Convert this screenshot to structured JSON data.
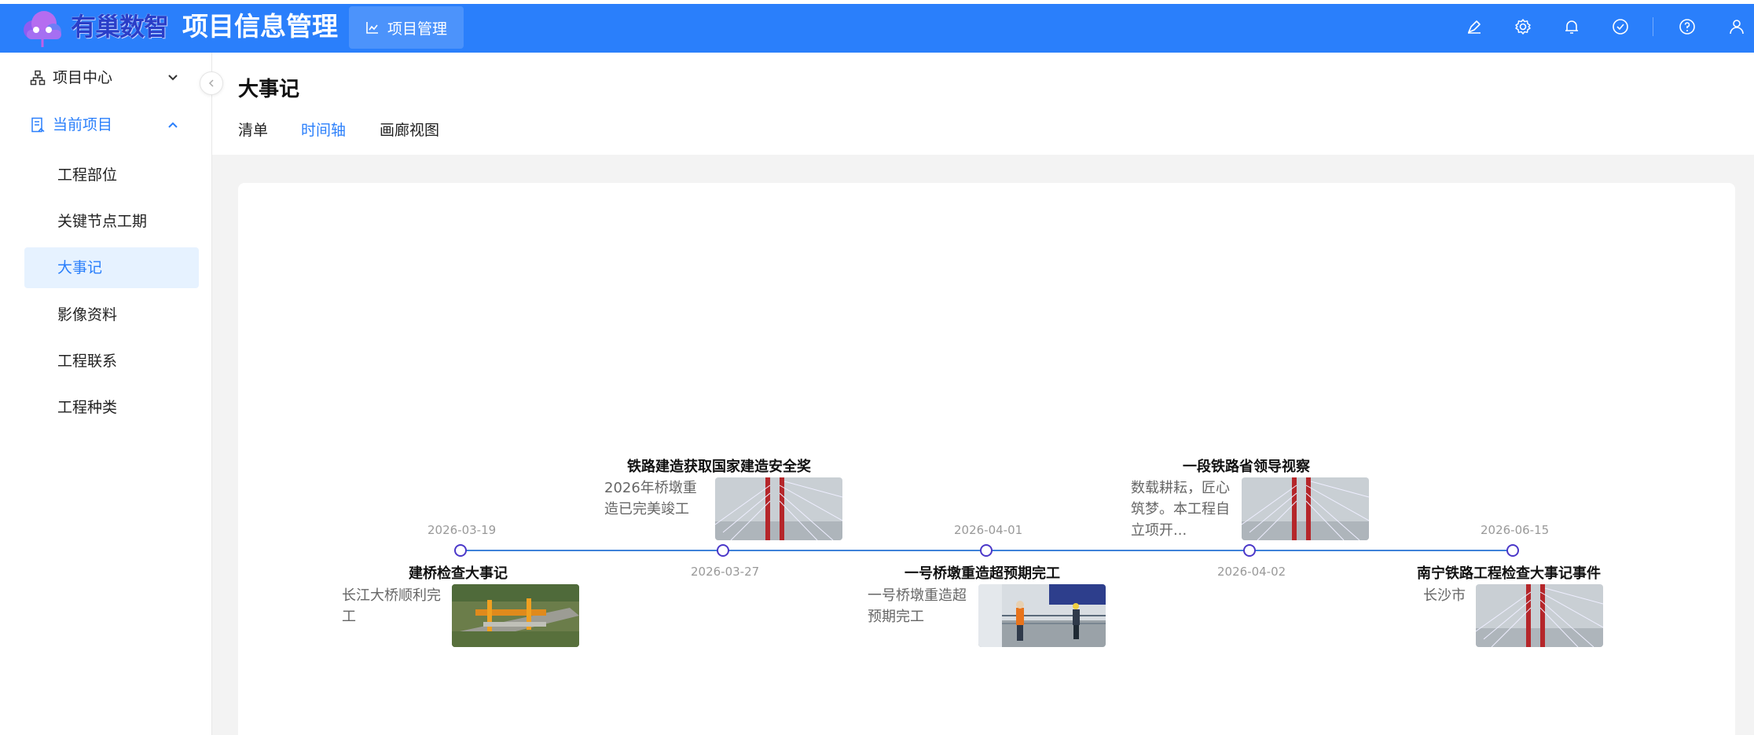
{
  "header": {
    "brand_name": "有巢数智",
    "app_title": "项目信息管理",
    "module_tab": "项目管理",
    "icons": [
      "pen-icon",
      "settings-icon",
      "bell-icon",
      "check-circle-icon",
      "help-icon",
      "user-icon"
    ],
    "accent_color": "#2a7ffb"
  },
  "sidebar": {
    "groups": [
      {
        "label": "项目中心",
        "icon": "org-chart-icon",
        "expanded": false
      },
      {
        "label": "当前项目",
        "icon": "project-doc-icon",
        "expanded": true
      }
    ],
    "items": [
      {
        "label": "工程部位"
      },
      {
        "label": "关键节点工期"
      },
      {
        "label": "大事记",
        "selected": true
      },
      {
        "label": "影像资料"
      },
      {
        "label": "工程联系"
      },
      {
        "label": "工程种类"
      }
    ]
  },
  "page": {
    "title": "大事记",
    "tabs": [
      {
        "label": "清单"
      },
      {
        "label": "时间轴",
        "active": true
      },
      {
        "label": "画廊视图"
      }
    ]
  },
  "timeline": {
    "events": [
      {
        "date": "2026-03-19",
        "title": "建桥检查大事记",
        "desc": "长江大桥顺利完工",
        "image": "construction-site-photo"
      },
      {
        "date": "2026-03-27",
        "title": "铁路建造获取国家建造安全奖",
        "desc": "2026年桥墩重造已完美竣工",
        "image": "bridge-cable-photo"
      },
      {
        "date": "2026-04-01",
        "title": "一号桥墩重造超预期完工",
        "desc": "一号桥墩重造超预期完工",
        "image": "workers-photo"
      },
      {
        "date": "2026-04-02",
        "title": "一段铁路省领导视察",
        "desc": "数载耕耘，匠心筑梦。本工程自立项开...",
        "image": "bridge-cable-photo"
      },
      {
        "date": "2026-06-15",
        "title": "南宁铁路工程检查大事记事件",
        "desc": "长沙市",
        "image": "bridge-cable-photo"
      }
    ]
  }
}
